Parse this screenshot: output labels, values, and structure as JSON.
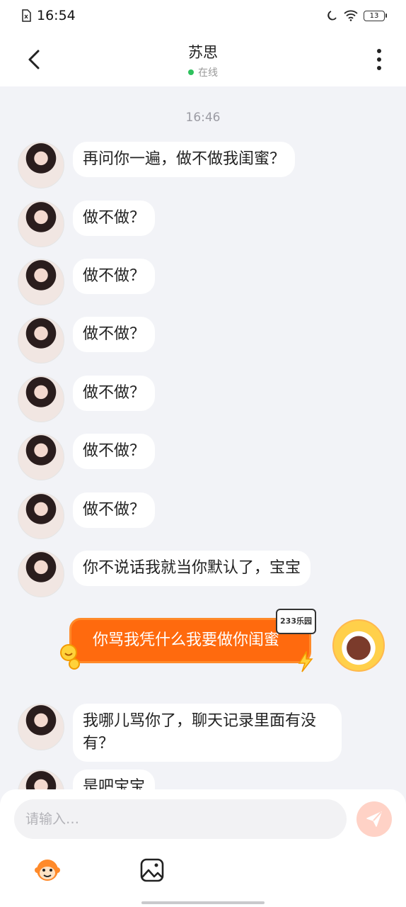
{
  "status_bar": {
    "time": "16:54",
    "battery": "13"
  },
  "header": {
    "title": "苏思",
    "status": "在线"
  },
  "chat": {
    "timestamp": "16:46",
    "incoming_messages": [
      "再问你一遍，做不做我闺蜜？",
      "做不做？",
      "做不做？",
      "做不做？",
      "做不做？",
      "做不做？",
      "做不做？",
      "你不说话我就当你默认了，宝宝"
    ],
    "outgoing_message": {
      "text": "你骂我凭什么我要做你闺蜜",
      "tag": "233乐园"
    },
    "incoming_after": [
      "我哪儿骂你了，聊天记录里面有没有？",
      "是吧宝宝"
    ]
  },
  "input": {
    "placeholder": "请输入…"
  },
  "colors": {
    "accent": "#ff6a0e",
    "online": "#2ec15d",
    "background": "#f2f3f7"
  }
}
